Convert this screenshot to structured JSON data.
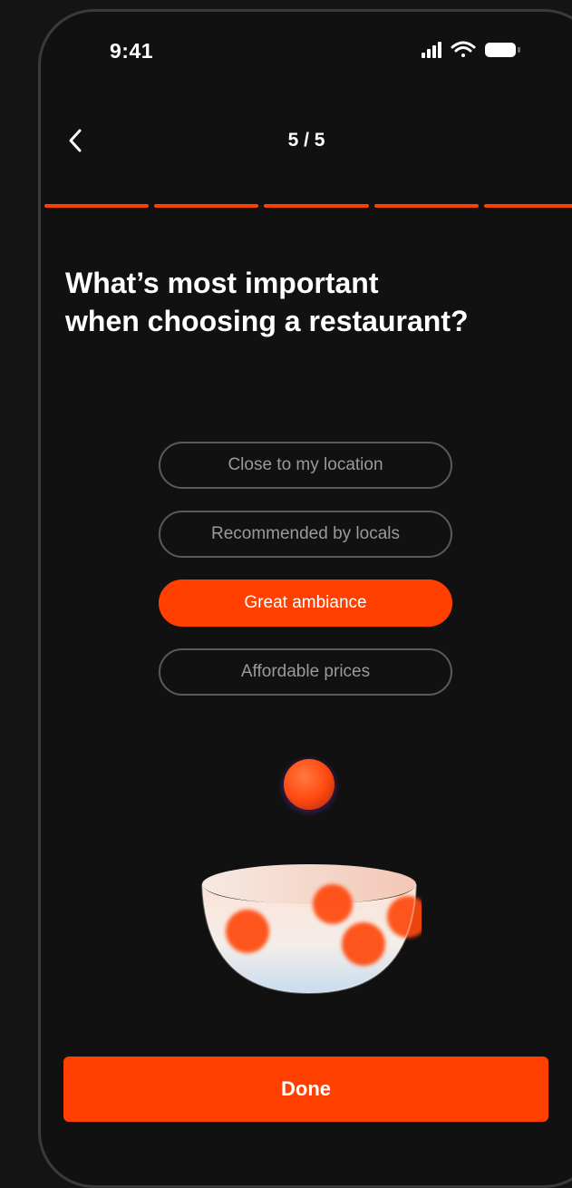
{
  "status_bar": {
    "time": "9:41",
    "icons": [
      "signal-icon",
      "wifi-icon",
      "battery-icon"
    ]
  },
  "nav": {
    "back_icon": "chevron-left-icon",
    "step": "5 / 5"
  },
  "progress": {
    "total_steps": 5,
    "completed_steps": 5,
    "color": "#ff4000"
  },
  "question": {
    "line1": "What’s most important",
    "line2": "when choosing a restaurant?"
  },
  "options": [
    {
      "label": "Close to my location",
      "selected": false
    },
    {
      "label": "Recommended by locals",
      "selected": false
    },
    {
      "label": "Great ambiance",
      "selected": true
    },
    {
      "label": "Affordable prices",
      "selected": false
    }
  ],
  "illustration": {
    "icon": "bowl-with-balls-icon"
  },
  "footer": {
    "done_label": "Done"
  },
  "colors": {
    "accent": "#ff4000",
    "background": "#111111",
    "text": "#ffffff",
    "muted": "#9a9a9a"
  }
}
